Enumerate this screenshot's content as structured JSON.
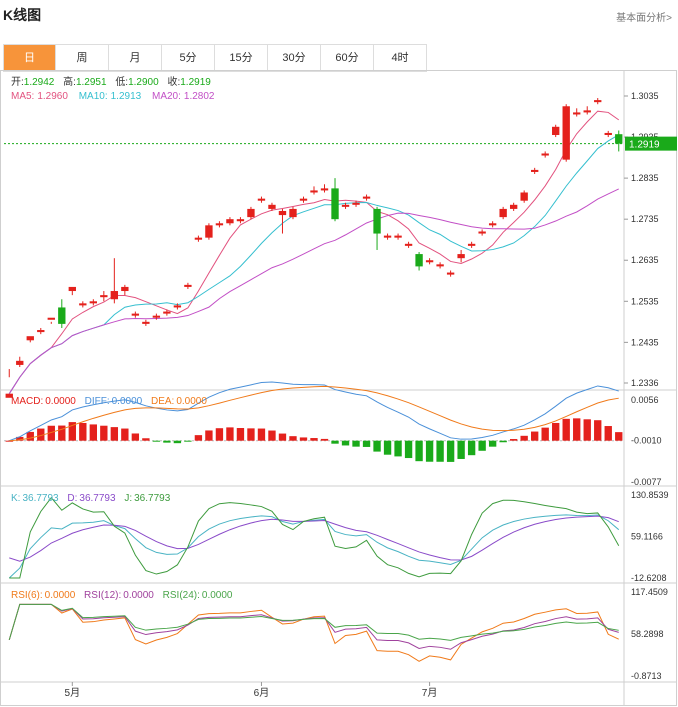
{
  "header": {
    "title": "K线图",
    "link": "基本面分析>"
  },
  "tabs": [
    "日",
    "周",
    "月",
    "5分",
    "15分",
    "30分",
    "60分",
    "4时"
  ],
  "active_tab": 0,
  "colors": {
    "up": "#e4211c",
    "down": "#1aaa1a",
    "ma5": "#e2527f",
    "ma10": "#35bfcf",
    "ma20": "#c24fc6",
    "diff": "#4a90d9",
    "dea": "#f07a1a",
    "k": "#49b3c4",
    "d": "#8a4bc9",
    "j": "#3e9b3e",
    "rsi6": "#f07a1a",
    "rsi12": "#a0429d",
    "rsi24": "#4aa54a",
    "price_tag": "#1aaa1a"
  },
  "chart_data": {
    "type": "candlestick",
    "x_labels": [
      {
        "label": "5月",
        "index": 6
      },
      {
        "label": "6月",
        "index": 24
      },
      {
        "label": "7月",
        "index": 40
      }
    ],
    "ohlc": [
      [
        1.23,
        1.231,
        1.235,
        1.237
      ],
      [
        1.238,
        1.239,
        1.2375,
        1.24
      ],
      [
        1.244,
        1.245,
        1.2435,
        1.2445
      ],
      [
        1.246,
        1.2465,
        1.2455,
        1.247
      ],
      [
        1.249,
        1.2495,
        1.248,
        1.2485
      ],
      [
        1.252,
        1.248,
        1.247,
        1.254
      ],
      [
        1.256,
        1.257,
        1.255,
        1.2565
      ],
      [
        1.2525,
        1.253,
        1.252,
        1.2535
      ],
      [
        1.253,
        1.2535,
        1.2525,
        1.254
      ],
      [
        1.2545,
        1.255,
        1.2535,
        1.256
      ],
      [
        1.254,
        1.256,
        1.253,
        1.264
      ],
      [
        1.256,
        1.257,
        1.255,
        1.2575
      ],
      [
        1.25,
        1.2505,
        1.2495,
        1.251
      ],
      [
        1.248,
        1.2485,
        1.2475,
        1.249
      ],
      [
        1.2495,
        1.25,
        1.249,
        1.2505
      ],
      [
        1.2505,
        1.251,
        1.25,
        1.2515
      ],
      [
        1.252,
        1.2525,
        1.2515,
        1.253
      ],
      [
        1.257,
        1.2575,
        1.2565,
        1.258
      ],
      [
        1.2685,
        1.269,
        1.268,
        1.2695
      ],
      [
        1.269,
        1.272,
        1.2685,
        1.2725
      ],
      [
        1.272,
        1.2725,
        1.2715,
        1.273
      ],
      [
        1.2725,
        1.2735,
        1.272,
        1.274
      ],
      [
        1.273,
        1.2735,
        1.2725,
        1.274
      ],
      [
        1.274,
        1.276,
        1.2735,
        1.2765
      ],
      [
        1.278,
        1.2785,
        1.2775,
        1.279
      ],
      [
        1.276,
        1.277,
        1.2755,
        1.2775
      ],
      [
        1.2745,
        1.2755,
        1.27,
        1.276
      ],
      [
        1.274,
        1.276,
        1.2735,
        1.2765
      ],
      [
        1.278,
        1.2785,
        1.2775,
        1.279
      ],
      [
        1.28,
        1.2805,
        1.2795,
        1.2815
      ],
      [
        1.2805,
        1.281,
        1.28,
        1.282
      ],
      [
        1.281,
        1.2735,
        1.273,
        1.2835
      ],
      [
        1.2765,
        1.277,
        1.276,
        1.2775
      ],
      [
        1.277,
        1.2775,
        1.2765,
        1.278
      ],
      [
        1.2785,
        1.279,
        1.278,
        1.2795
      ],
      [
        1.276,
        1.27,
        1.266,
        1.2765
      ],
      [
        1.269,
        1.2695,
        1.2685,
        1.27
      ],
      [
        1.269,
        1.2695,
        1.2685,
        1.27
      ],
      [
        1.267,
        1.2675,
        1.2665,
        1.268
      ],
      [
        1.265,
        1.262,
        1.261,
        1.2655
      ],
      [
        1.263,
        1.2635,
        1.2625,
        1.264
      ],
      [
        1.262,
        1.2625,
        1.2615,
        1.263
      ],
      [
        1.26,
        1.2605,
        1.2595,
        1.261
      ],
      [
        1.264,
        1.265,
        1.263,
        1.266
      ],
      [
        1.267,
        1.2675,
        1.2665,
        1.268
      ],
      [
        1.27,
        1.2705,
        1.2695,
        1.271
      ],
      [
        1.272,
        1.2725,
        1.2715,
        1.273
      ],
      [
        1.274,
        1.276,
        1.2735,
        1.2765
      ],
      [
        1.276,
        1.277,
        1.2755,
        1.2775
      ],
      [
        1.278,
        1.28,
        1.2775,
        1.2805
      ],
      [
        1.285,
        1.2855,
        1.2845,
        1.286
      ],
      [
        1.289,
        1.2895,
        1.2885,
        1.29
      ],
      [
        1.294,
        1.296,
        1.2935,
        1.2965
      ],
      [
        1.288,
        1.301,
        1.2875,
        1.3015
      ],
      [
        1.299,
        1.2995,
        1.2985,
        1.3005
      ],
      [
        1.2995,
        1.3,
        1.299,
        1.301
      ],
      [
        1.302,
        1.3025,
        1.3015,
        1.303
      ],
      [
        1.294,
        1.2945,
        1.2935,
        1.295
      ],
      [
        1.2942,
        1.2919,
        1.29,
        1.2951
      ]
    ],
    "price_scale": {
      "ticks": [
        "1.3035",
        "1.2935",
        "1.2835",
        "1.2735",
        "1.2635",
        "1.2535",
        "1.2435",
        "1.2336"
      ],
      "min": 1.2336,
      "max": 1.3035,
      "last": "1.2919",
      "last_value": 1.2919
    },
    "ohlc_text": {
      "open_label": "开:",
      "open": "1.2942",
      "high_label": "高:",
      "high": "1.2951",
      "low_label": "低:",
      "low": "1.2900",
      "close_label": "收:",
      "close": "1.2919"
    },
    "ma": {
      "ma5_label": "MA5:",
      "ma5": "1.2960",
      "ma10_label": "MA10:",
      "ma10": "1.2913",
      "ma20_label": "MA20:",
      "ma20": "1.2802"
    },
    "macd": {
      "label": "MACD:",
      "value": "0.0000",
      "diff_label": "DIFF:",
      "diff": "0.0000",
      "dea_label": "DEA:",
      "dea": "0.0000",
      "ticks": [
        "0.0056",
        "-0.0010",
        "-0.0077"
      ],
      "min": -0.0077,
      "max": 0.0056
    },
    "kdj": {
      "k_label": "K:",
      "k": "36.7793",
      "d_label": "D:",
      "d": "36.7793",
      "j_label": "J:",
      "j": "36.7793",
      "ticks": [
        "130.8539",
        "59.1166",
        "-12.6208"
      ],
      "min": -12.6208,
      "max": 130.8539
    },
    "rsi": {
      "rsi6_label": "RSI(6):",
      "rsi6": "0.0000",
      "rsi12_label": "RSI(12):",
      "rsi12": "0.0000",
      "rsi24_label": "RSI(24):",
      "rsi24": "0.0000",
      "ticks": [
        "117.4509",
        "58.2898",
        "-0.8713"
      ],
      "min": -0.8713,
      "max": 117.4509
    }
  }
}
